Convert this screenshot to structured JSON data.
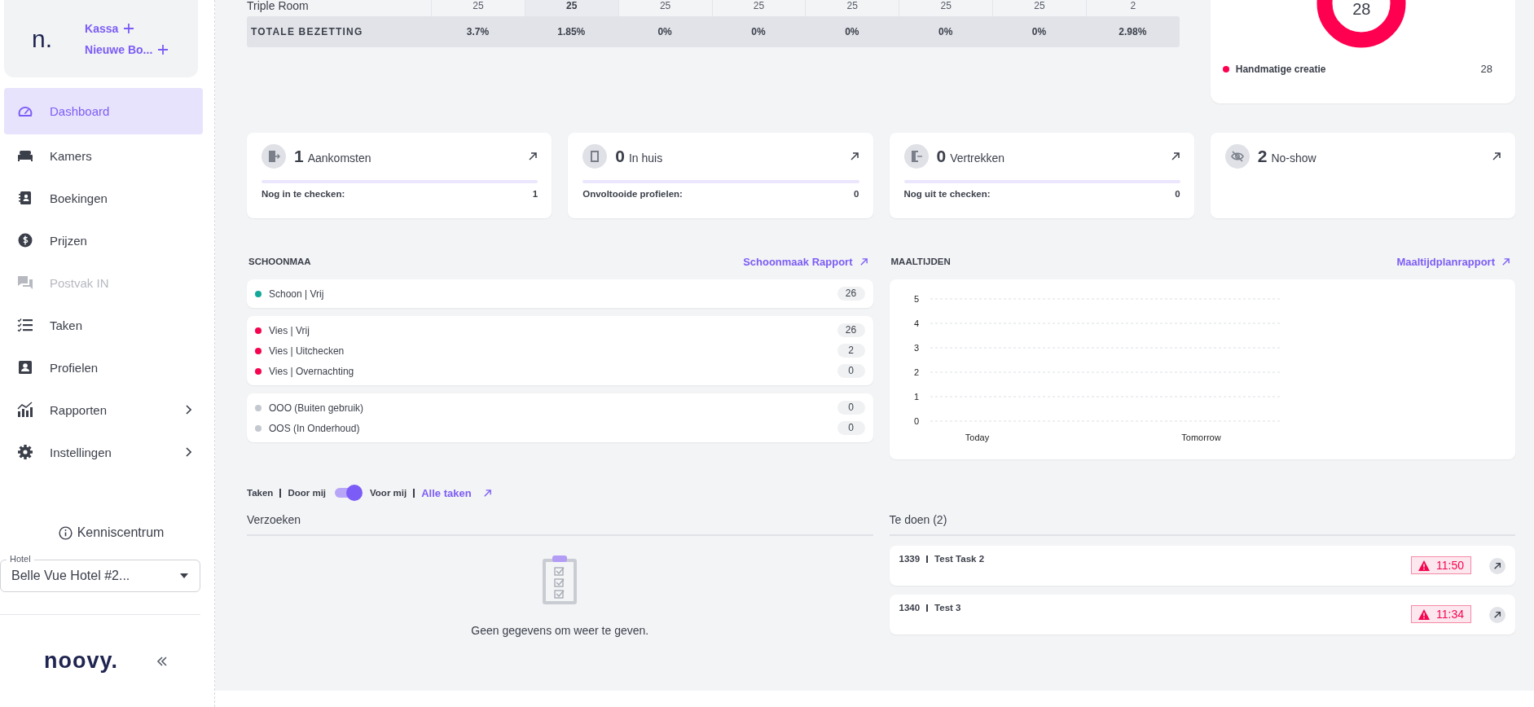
{
  "sidebar": {
    "logo": "n.",
    "actions": [
      "Kassa",
      "Nieuwe Bo..."
    ],
    "items": [
      {
        "label": "Dashboard",
        "selected": true,
        "disabled": false,
        "submenu": false
      },
      {
        "label": "Kamers",
        "selected": false,
        "disabled": false,
        "submenu": false
      },
      {
        "label": "Boekingen",
        "selected": false,
        "disabled": false,
        "submenu": false
      },
      {
        "label": "Prijzen",
        "selected": false,
        "disabled": false,
        "submenu": false
      },
      {
        "label": "Postvak IN",
        "selected": false,
        "disabled": true,
        "submenu": false
      },
      {
        "label": "Taken",
        "selected": false,
        "disabled": false,
        "submenu": false
      },
      {
        "label": "Profielen",
        "selected": false,
        "disabled": false,
        "submenu": false
      },
      {
        "label": "Rapporten",
        "selected": false,
        "disabled": false,
        "submenu": true
      },
      {
        "label": "Instellingen",
        "selected": false,
        "disabled": false,
        "submenu": true
      }
    ],
    "help": "Kenniscentrum",
    "hotel": {
      "label": "Hotel",
      "value": "Belle Vue Hotel #2..."
    },
    "brand": "noovy."
  },
  "occupancy_table": {
    "columns": [
      {
        "selected": false
      },
      {
        "selected": true
      },
      {
        "selected": false
      },
      {
        "selected": false
      },
      {
        "selected": false
      },
      {
        "selected": false
      },
      {
        "selected": false
      },
      {
        "selected": false
      }
    ],
    "rows": [
      {
        "label": "Triple Room",
        "cells": [
          "25",
          "25",
          "25",
          "25",
          "25",
          "25",
          "25",
          "2"
        ]
      }
    ],
    "total": {
      "label": "TOTALE BEZETTING",
      "cells": [
        "3.7%",
        "1.85%",
        "0%",
        "0%",
        "0%",
        "0%",
        "0%",
        "2.98%"
      ]
    }
  },
  "source_chart": {
    "center_label": "28",
    "legend": [
      {
        "label": "Handmatige creatie",
        "value": "28",
        "color": "#ff0050"
      }
    ]
  },
  "stats": [
    {
      "kind": "progress",
      "count": "1",
      "label": "Aankomsten",
      "detail_label": "Nog in te checken:",
      "detail_value": "1",
      "level": 0
    },
    {
      "kind": "progress",
      "count": "0",
      "label": "In huis",
      "detail_label": "Onvoltooide profielen:",
      "detail_value": "0",
      "level": 0
    },
    {
      "kind": "progress",
      "count": "0",
      "label": "Vertrekken",
      "detail_label": "Nog uit te checken:",
      "detail_value": "0",
      "level": 0
    },
    {
      "kind": "plain",
      "count": "2",
      "label": "No-show"
    }
  ],
  "cleaning": {
    "title": "SCHOONMAA",
    "report_link": "Schoonmaak Rapport",
    "groups": [
      {
        "items": [
          {
            "label": "Schoon | Vrij",
            "count": "26",
            "color": "#14a89a"
          }
        ]
      },
      {
        "items": [
          {
            "label": "Vies | Vrij",
            "count": "26",
            "color": "#f5044f"
          },
          {
            "label": "Vies | Uitchecken",
            "count": "2",
            "color": "#f5044f"
          },
          {
            "label": "Vies | Overnachting",
            "count": "0",
            "color": "#f5044f"
          }
        ]
      },
      {
        "items": [
          {
            "label": "OOO (Buiten gebruik)",
            "count": "0",
            "color": "#c4c8d0"
          },
          {
            "label": "OOS (In Onderhoud)",
            "count": "0",
            "color": "#c4c8d0"
          }
        ]
      }
    ]
  },
  "meals": {
    "title": "MAALTIJDEN",
    "report_link": "Maaltijdplanrapport",
    "chart_data": {
      "type": "bar",
      "categories": [
        "Today",
        "Tomorrow"
      ],
      "values": [
        0,
        0
      ],
      "ylim": [
        0,
        5
      ],
      "grid": true,
      "yticks": [
        0,
        1,
        2,
        3,
        4,
        5
      ]
    }
  },
  "tasks": {
    "title": "Taken",
    "toggle_left": "Door mij",
    "toggle_right": "Voor mij",
    "toggle_on": true,
    "all_link": "Alle taken",
    "requests": {
      "title": "Verzoeken",
      "empty_text": "Geen gegevens om weer te geven."
    },
    "todo": {
      "title": "Te doen (2)",
      "items": [
        {
          "id": "1339",
          "title": "Test Task 2",
          "time": "11:50",
          "overdue": true
        },
        {
          "id": "1340",
          "title": "Test 3",
          "time": "11:34",
          "overdue": true
        }
      ]
    }
  }
}
